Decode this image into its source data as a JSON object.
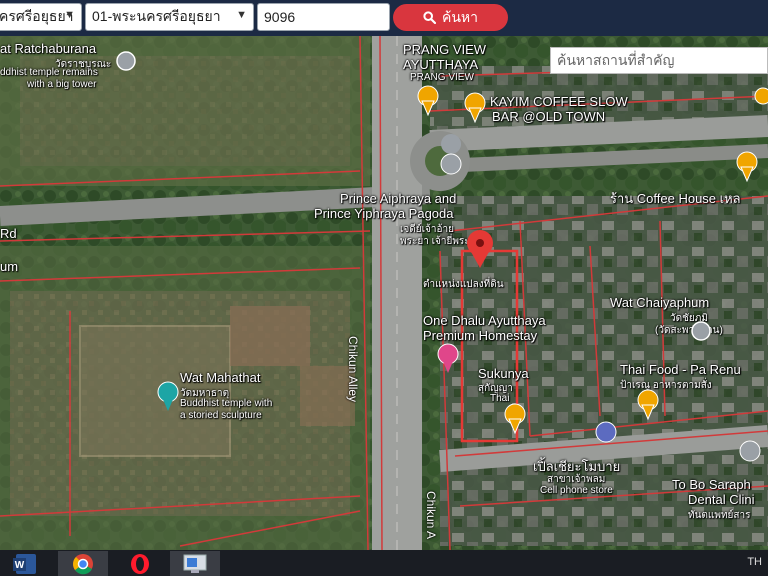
{
  "toolbar": {
    "province_select": "ครศรีอยุธยา",
    "district_select": "01-พระนครศรีอยุธยา",
    "parcel_input": "9096",
    "search_button": "ค้นหา"
  },
  "map": {
    "place_search_placeholder": "ค้นหาสถานที่สำคัญ",
    "labels": {
      "wat_ratchaburana": "at Ratchaburana",
      "wat_ratchaburana_th": "วัดราชบูรณะ",
      "wat_ratchaburana_desc1": "ddhist temple remains",
      "wat_ratchaburana_desc2": "with a big tower",
      "prang_view": "PRANG VIEW",
      "prang_view_ayutthaya": "AYUTTHAYA",
      "prang_view_sub": "PRANG VIEW",
      "kayim_coffee1": "KAYIM COFFEE SLOW",
      "kayim_coffee2": "BAR @OLD TOWN",
      "coffee_house": "ร้าน Coffee House เหล",
      "pagoda1": "Prince Aiphraya and",
      "pagoda2": "Prince Yiphraya Pagoda",
      "pagoda_th1": "เจดีย์เจ้าอ้าย",
      "pagoda_th2": "พระยา เจ้ายี่พระ",
      "rd": "Rd",
      "um": "um",
      "parcel_position": "ตำแหน่งแปลงที่ดิน",
      "wat_chaiyaphum": "Wat Chaiyaphum",
      "wat_chaiyaphum_th1": "วัดชัยภูมิ",
      "wat_chaiyaphum_th2": "(วัดสะพานถ่าน)",
      "one_dhalu1": "One Dhalu Ayutthaya",
      "one_dhalu2": "Premium Homestay",
      "chikun_alley": "Chikun Alley",
      "chikun_alley2": "Chikun A",
      "wat_mahathat": "Wat Mahathat",
      "wat_mahathat_th": "วัดมหาธาตุ",
      "wat_mahathat_desc1": "Buddhist temple with",
      "wat_mahathat_desc2": "a storied sculpture",
      "sukunya": "Sukunya",
      "sukunya_th": "สุกัญญา",
      "sukunya_sub": "Thai",
      "thai_food1": "Thai Food - Pa Renu",
      "thai_food2": "ป้าเรณู อาหารตามสั่ง",
      "cell_phone_th1": "เปิ้ลเชียะโมบาย",
      "cell_phone_th2": "สาขาเจ้าพลม",
      "cell_phone_en": "Cell phone store",
      "to_bo1": "To Bo Saraph",
      "to_bo2": "Dental Clini",
      "to_bo_th": "ทันตแพทย์สาร"
    }
  },
  "taskbar": {
    "tray_text": "TH"
  },
  "colors": {
    "topbar": "#1c2a44",
    "search_button": "#d9363e",
    "parcel_line": "#d23a3a",
    "marker_orange": "#f0a500",
    "marker_red": "#e53935"
  }
}
